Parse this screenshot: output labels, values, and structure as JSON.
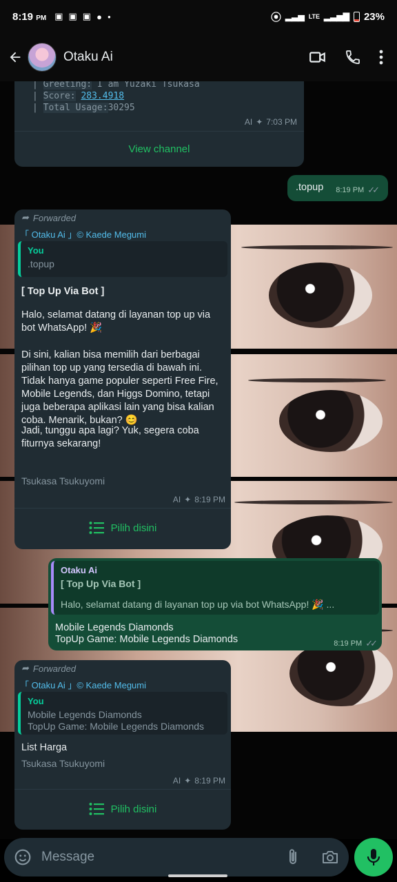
{
  "status_bar": {
    "time": "8:19",
    "time_suffix": "PM",
    "battery_pct": "23%",
    "network": "LTE"
  },
  "header": {
    "contact_name": "Otaku Ai"
  },
  "channel_card": {
    "line1_key": "Greeting:",
    "line1_val": "I am Yuzaki Tsukasa",
    "line2_key": "Score:",
    "line2_val": "283.4918",
    "line3_key": "Total Usage:",
    "line3_val": "30295",
    "ai_label": "AI",
    "time": "7:03 PM",
    "button_label": "View channel"
  },
  "msg_topup": {
    "text": ".topup",
    "time": "8:19 PM"
  },
  "msg_bot1": {
    "forwarded_label": "Forwarded",
    "channel": "「 Otaku Ai 」© Kaede Megumi",
    "quote_who": "You",
    "quote_text": ".topup",
    "heading": "[ Top Up Via Bot ]",
    "para1": "Halo, selamat datang di layanan top up via bot WhatsApp! 🎉",
    "para2": "Di sini, kalian bisa memilih dari berbagai pilihan top up yang tersedia di bawah ini. Tidak hanya game populer seperti Free Fire, Mobile Legends, dan Higgs Domino, tetapi juga beberapa aplikasi lain yang bisa kalian coba. Menarik, bukan? 😊",
    "para3": "Jadi, tunggu apa lagi? Yuk, segera coba fiturnya sekarang!",
    "footer": "Tsukasa Tsukuyomi",
    "ai_label": "AI",
    "time": "8:19 PM",
    "button_label": "Pilih disini"
  },
  "msg_reply": {
    "quote_who": "Otaku Ai",
    "quote_heading": "[ Top Up Via Bot ]",
    "quote_text": "Halo, selamat datang di layanan top up via bot WhatsApp! 🎉 ...",
    "line1": "Mobile Legends Diamonds",
    "line2": "TopUp Game: Mobile Legends Diamonds",
    "time": "8:19 PM"
  },
  "msg_bot2": {
    "forwarded_label": "Forwarded",
    "channel": "「 Otaku Ai 」© Kaede Megumi",
    "quote_who": "You",
    "quote_line1": "Mobile Legends Diamonds",
    "quote_line2": "TopUp Game: Mobile Legends Diamonds",
    "body": "List Harga",
    "footer": "Tsukasa Tsukuyomi",
    "ai_label": "AI",
    "time": "8:19 PM",
    "button_label": "Pilih disini"
  },
  "input": {
    "placeholder": "Message"
  },
  "colors": {
    "incoming_bubble": "#202c33",
    "outgoing_bubble": "#144d37",
    "accent_green": "#21c063",
    "link_blue": "#53bdeb"
  }
}
